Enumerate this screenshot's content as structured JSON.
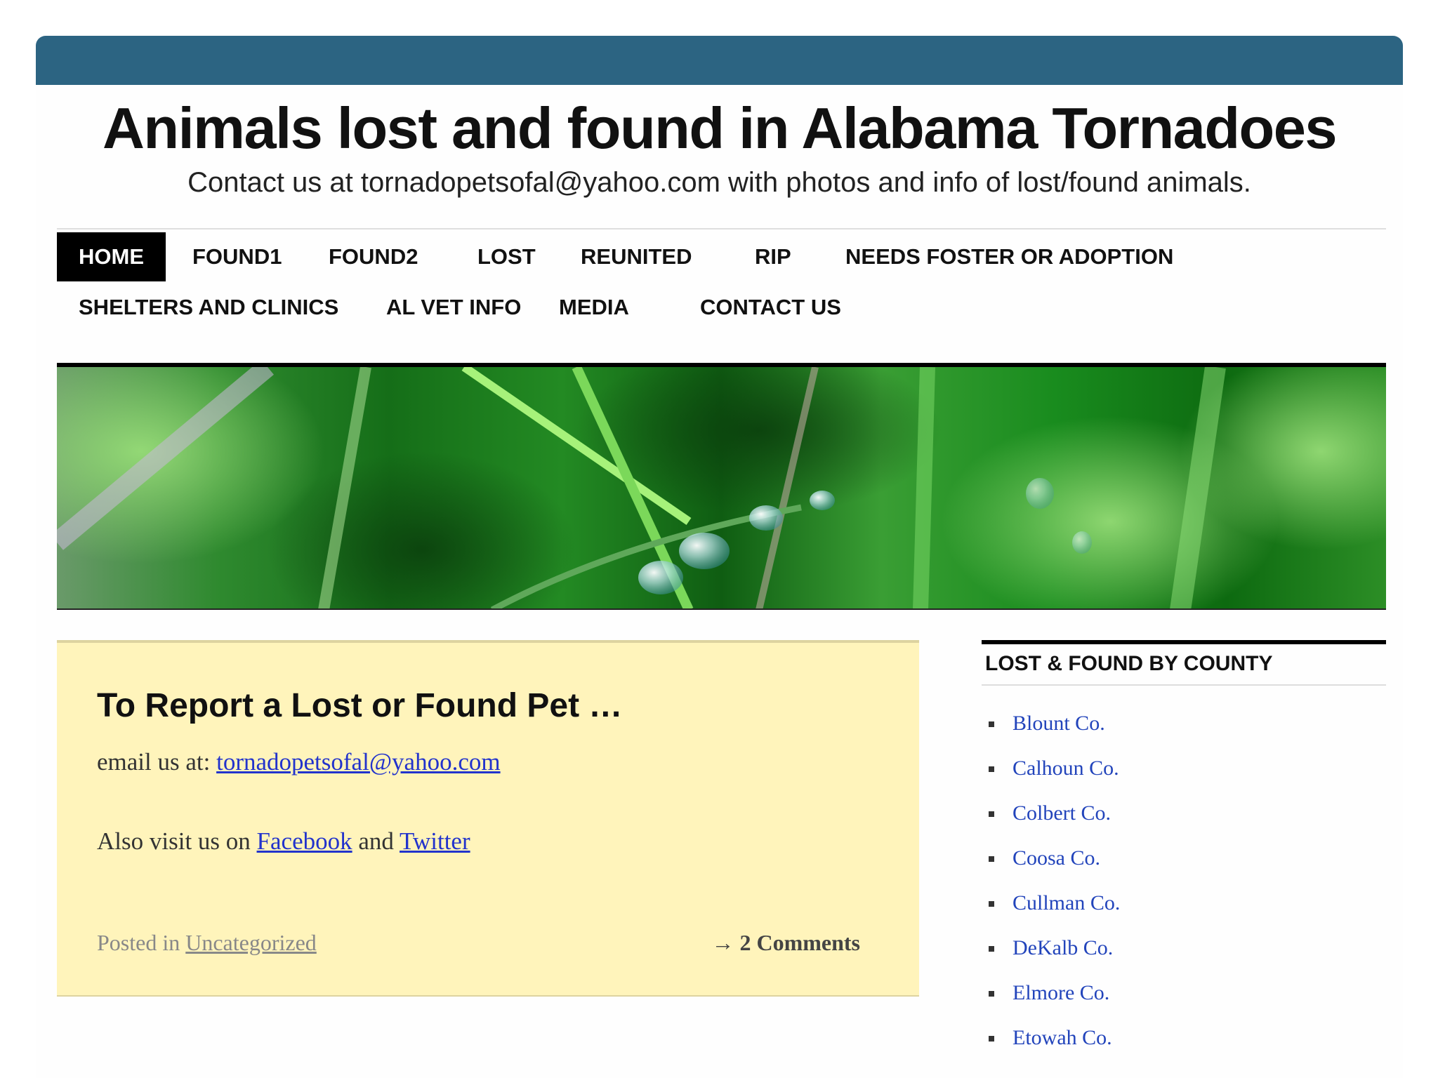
{
  "colors": {
    "top_bar": "#2c6482",
    "post_background": "#fff4bb",
    "link": "#2244bb"
  },
  "site": {
    "title": "Animals lost and found in Alabama Tornadoes",
    "description": "Contact us at tornadopetsofal@yahoo.com with photos and info of lost/found animals."
  },
  "nav": {
    "items": [
      {
        "label": "HOME",
        "active": true
      },
      {
        "label": "FOUND1"
      },
      {
        "label": "FOUND2"
      },
      {
        "label": "LOST"
      },
      {
        "label": "REUNITED"
      },
      {
        "label": "RIP"
      },
      {
        "label": "NEEDS FOSTER OR ADOPTION"
      },
      {
        "label": "SHELTERS AND CLINICS"
      },
      {
        "label": "AL VET INFO"
      },
      {
        "label": "MEDIA"
      },
      {
        "label": "CONTACT US"
      }
    ]
  },
  "post": {
    "title": "To Report a Lost or Found Pet …",
    "email_prefix": "email us at: ",
    "email_link": "tornadopetsofal@yahoo.com",
    "visit_prefix": "Also visit us on ",
    "facebook": "Facebook",
    "and": " and ",
    "twitter": "Twitter",
    "posted_in": "Posted in ",
    "category": "Uncategorized",
    "comments": "→ 2 Comments"
  },
  "sidebar": {
    "heading": "LOST & FOUND BY COUNTY",
    "counties": [
      "Blount Co.",
      "Calhoun Co.",
      "Colbert Co.",
      "Coosa Co.",
      "Cullman Co.",
      "DeKalb Co.",
      "Elmore Co.",
      "Etowah Co."
    ]
  }
}
